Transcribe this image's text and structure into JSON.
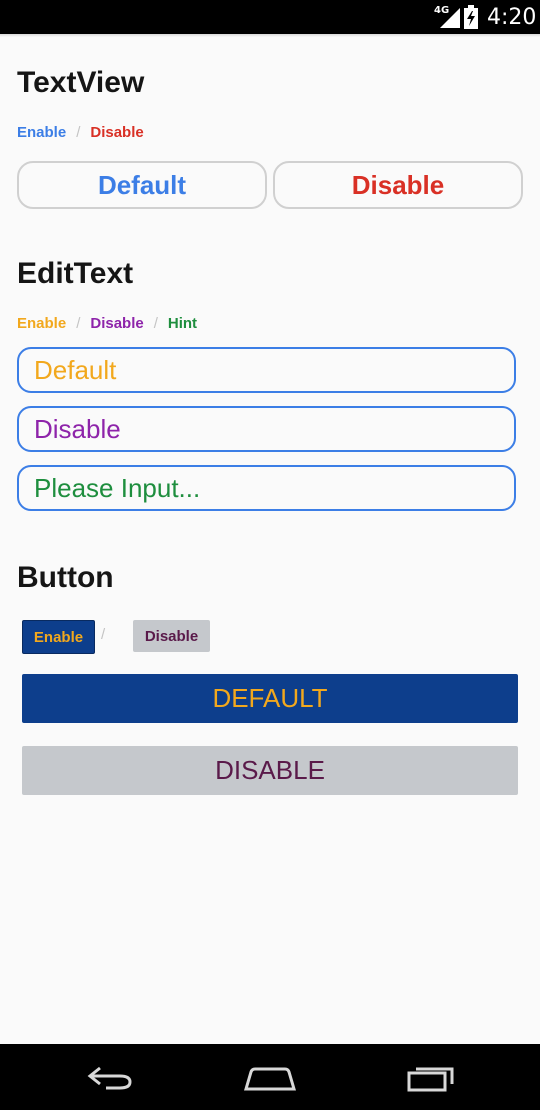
{
  "status_bar": {
    "network": "4G",
    "time": "4:20",
    "icons": [
      "signal-icon",
      "battery-charging-icon"
    ]
  },
  "textview": {
    "title": "TextView",
    "tag_enable": "Enable",
    "tag_disable": "Disable",
    "separator": "/",
    "box_default": "Default",
    "box_disable": "Disable"
  },
  "edittext": {
    "title": "EditText",
    "tag_enable": "Enable",
    "tag_disable": "Disable",
    "tag_hint": "Hint",
    "separator": "/",
    "field_default": "Default",
    "field_disable": "Disable",
    "field_hint": "Please Input..."
  },
  "button": {
    "title": "Button",
    "small_enable": "Enable",
    "small_disable": "Disable",
    "separator": "/",
    "big_default": "DEFAULT",
    "big_disable": "DISABLE"
  },
  "nav_bar": {
    "icons": [
      "back-icon",
      "home-icon",
      "recents-icon"
    ]
  },
  "colors": {
    "blue": "#3c7ee6",
    "red": "#d93025",
    "orange": "#f2a81d",
    "purple": "#8e24aa",
    "green": "#1e8e3e",
    "navy": "#0d3e8c",
    "gray_btn": "#c5c8cc",
    "dark_plum": "#5a1a4a"
  }
}
